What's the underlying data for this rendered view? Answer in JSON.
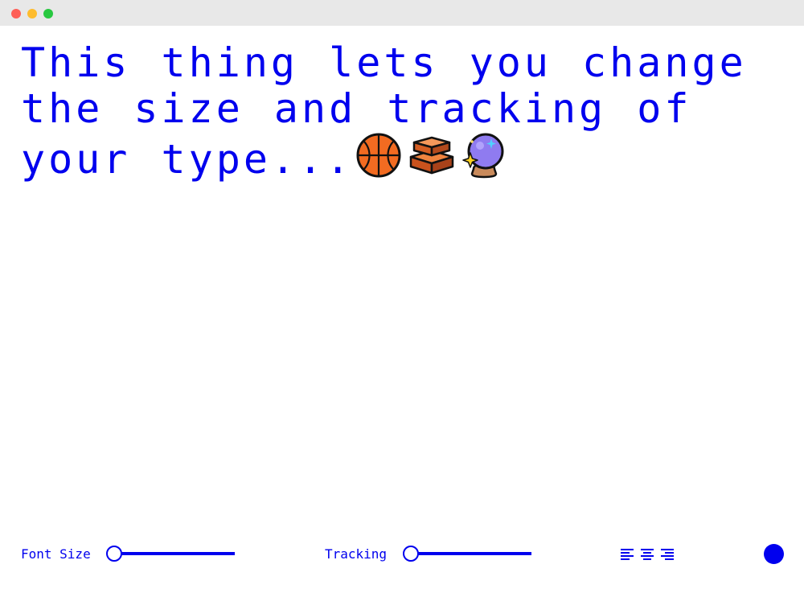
{
  "editor": {
    "line1": "This thing lets you change",
    "line2": "the size and tracking of",
    "line3": "your type...",
    "emojis": [
      "basketball-icon",
      "bricks-icon",
      "crystal-ball-icon"
    ]
  },
  "controls": {
    "font_size": {
      "label": "Font Size",
      "value": 0
    },
    "tracking": {
      "label": "Tracking",
      "value": 0
    },
    "alignment": {
      "options": [
        "align-left-icon",
        "align-center-icon",
        "align-right-icon"
      ]
    },
    "text_color": "#0000ee"
  },
  "colors": {
    "accent": "#0000ee",
    "titlebar": "#e8e8e8",
    "traffic_close": "#fe5f57",
    "traffic_minimize": "#febc2e",
    "traffic_zoom": "#28c840"
  }
}
